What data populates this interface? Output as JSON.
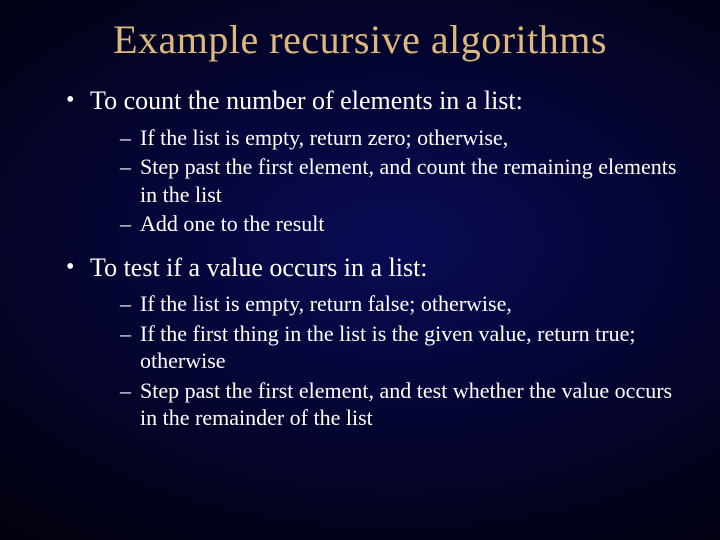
{
  "title": "Example recursive algorithms",
  "bullets": [
    {
      "text": "To count the number of elements in a list:",
      "sub": [
        "If the list is empty, return zero; otherwise,",
        "Step past the first element, and count the remaining elements in the list",
        "Add one to the result"
      ]
    },
    {
      "text": "To test if a value occurs in a list:",
      "sub": [
        "If the list is empty, return false; otherwise,",
        "If the first thing in the list is the given value, return true; otherwise",
        "Step past the first element, and test whether the value occurs in the remainder of the list"
      ]
    }
  ]
}
